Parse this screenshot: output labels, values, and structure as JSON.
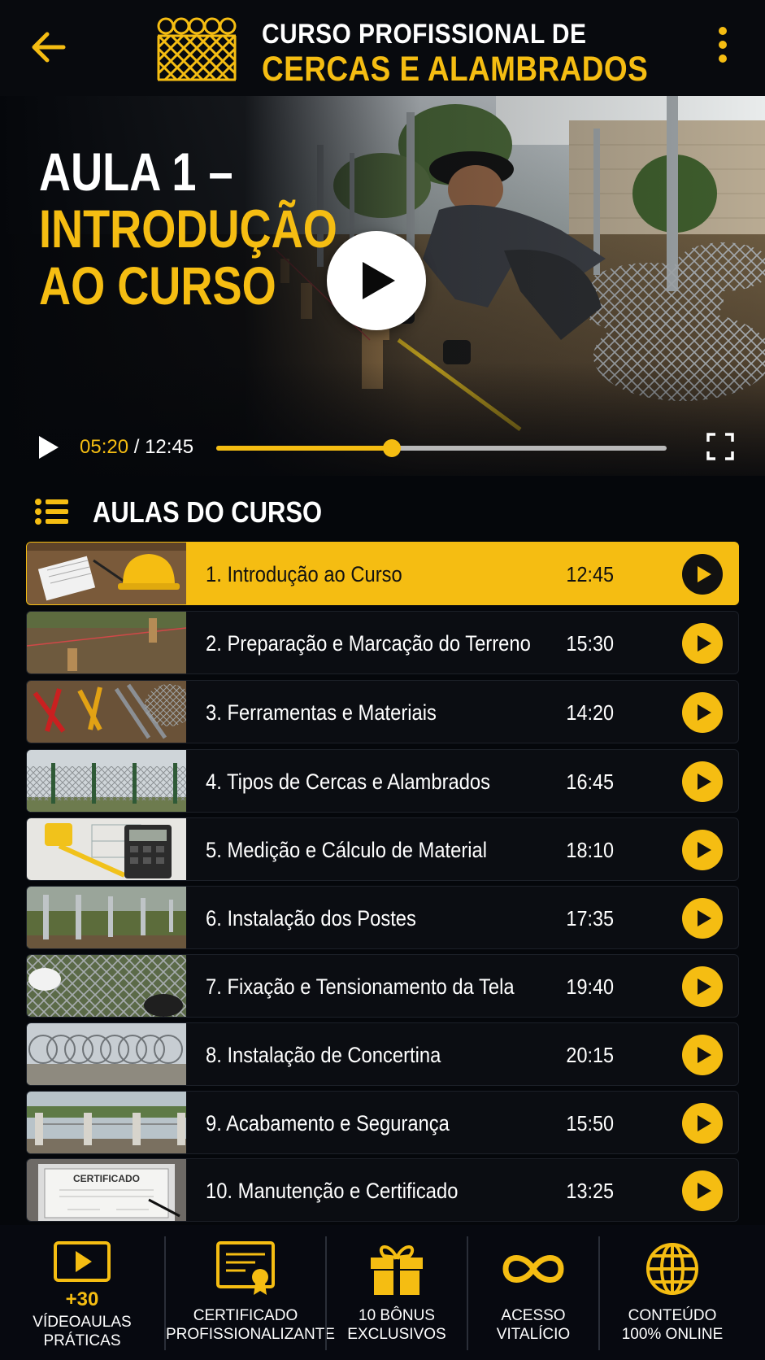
{
  "header": {
    "title_line1": "CURSO PROFISSIONAL DE",
    "title_line2": "CERCAS E ALAMBRADOS",
    "back_icon": "arrow-left-icon",
    "menu_icon": "kebab-menu-icon",
    "logo_icon": "fence-wire-logo"
  },
  "video": {
    "title_line1": "AULA 1 –",
    "title_line2": "INTRODUÇÃO",
    "title_line3": "AO CURSO",
    "current_time": "05:20",
    "separator": " / ",
    "total_time": "12:45",
    "progress_fraction": 0.39
  },
  "section": {
    "title": "AULAS DO CURSO"
  },
  "lessons": [
    {
      "number": "1.",
      "title": "Introdução ao Curso",
      "duration": "12:45",
      "active": true
    },
    {
      "number": "2.",
      "title": "Preparação e Marcação do Terreno",
      "duration": "15:30",
      "active": false
    },
    {
      "number": "3.",
      "title": "Ferramentas e Materiais",
      "duration": "14:20",
      "active": false
    },
    {
      "number": "4.",
      "title": "Tipos de Cercas e Alambrados",
      "duration": "16:45",
      "active": false
    },
    {
      "number": "5.",
      "title": "Medição e Cálculo de Material",
      "duration": "18:10",
      "active": false
    },
    {
      "number": "6.",
      "title": "Instalação dos Postes",
      "duration": "17:35",
      "active": false
    },
    {
      "number": "7.",
      "title": "Fixação e Tensionamento da Tela",
      "duration": "19:40",
      "active": false
    },
    {
      "number": "8.",
      "title": "Instalação de Concertina",
      "duration": "20:15",
      "active": false
    },
    {
      "number": "9.",
      "title": "Acabamento e Segurança",
      "duration": "15:50",
      "active": false
    },
    {
      "number": "10.",
      "title": "Manutenção e Certificado",
      "duration": "13:25",
      "active": false
    }
  ],
  "thumb_texts": {
    "certificate": "CERTIFICADO"
  },
  "features": [
    {
      "icon": "video-play-icon",
      "badge": "+30",
      "line1": "VÍDEOAULAS",
      "line2": "PRÁTICAS"
    },
    {
      "icon": "certificate-icon",
      "badge": "",
      "line1": "CERTIFICADO",
      "line2": "PROFISSIONALIZANTE"
    },
    {
      "icon": "gift-icon",
      "badge": "",
      "line1": "10 BÔNUS",
      "line2": "EXCLUSIVOS"
    },
    {
      "icon": "infinity-icon",
      "badge": "",
      "line1": "ACESSO",
      "line2": "VITALÍCIO"
    },
    {
      "icon": "globe-icon",
      "badge": "",
      "line1": "CONTEÚDO",
      "line2": "100% ONLINE"
    }
  ],
  "colors": {
    "accent": "#f5bd12",
    "background": "#05070b",
    "row_background": "#0b0d12"
  }
}
